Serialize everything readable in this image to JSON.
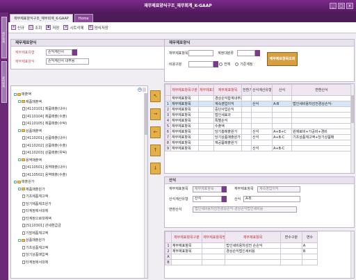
{
  "window": {
    "title": "재무제표양식구조_재무회계_K-GAAP",
    "btn_min": "_",
    "btn_max": "□",
    "btn_close": "x"
  },
  "left_strip": {
    "tab1": "재무회계",
    "tab2": "관리회계"
  },
  "tabs": [
    {
      "label": "재무제표양식구조_재무회계_K-GAAP"
    },
    {
      "label": "Home"
    }
  ],
  "toolbar": {
    "new": "신규",
    "query": "조회",
    "save": "저장",
    "delete": "시트삭제",
    "copy": "양식저장"
  },
  "left_panel": {
    "title": "재무제표양식",
    "fs_label": "재무제표유형",
    "fs_value": "손익계산서",
    "form_label": "재무제표양식",
    "form_value": "손익계산서 내부용"
  },
  "tree": [
    {
      "text": "매출액",
      "lvl": 0,
      "kind": "folder"
    },
    {
      "text": "제품매출액",
      "lvl": 1,
      "kind": "folder"
    },
    {
      "text": "[4110101] 제품매출(내수)",
      "lvl": 2,
      "kind": "leaf"
    },
    {
      "text": "[4110104] 제품매출(수출)",
      "lvl": 2,
      "kind": "leaf"
    },
    {
      "text": "[4110105] 제품매출(수탁)",
      "lvl": 2,
      "kind": "leaf"
    },
    {
      "text": "상품매출액",
      "lvl": 1,
      "kind": "folder"
    },
    {
      "text": "[4110201] 상품매출(내수)",
      "lvl": 2,
      "kind": "leaf"
    },
    {
      "text": "[4110202] 상품매출(수출)",
      "lvl": 2,
      "kind": "leaf"
    },
    {
      "text": "[4110203] 상품매출(위탁)",
      "lvl": 2,
      "kind": "leaf"
    },
    {
      "text": "용역매출액",
      "lvl": 1,
      "kind": "folder"
    },
    {
      "text": "[4110501] 용역매출(내수)",
      "lvl": 2,
      "kind": "leaf"
    },
    {
      "text": "[4110502] 용역매출(수출)",
      "lvl": 2,
      "kind": "leaf"
    },
    {
      "text": "매출원가",
      "lvl": 0,
      "kind": "folder"
    },
    {
      "text": "제품매출원가",
      "lvl": 1,
      "kind": "folder"
    },
    {
      "text": "기초제품재고액",
      "lvl": 2,
      "kind": "leaf"
    },
    {
      "text": "당기제품제조원가",
      "lvl": 2,
      "kind": "leaf"
    },
    {
      "text": "타계정에서대체",
      "lvl": 2,
      "kind": "leaf"
    },
    {
      "text": "타계정으로대체액",
      "lvl": 2,
      "kind": "leaf"
    },
    {
      "text": "[5110301] 관세환급금",
      "lvl": 2,
      "kind": "leaf"
    },
    {
      "text": "기말제품재고액",
      "lvl": 2,
      "kind": "leaf"
    },
    {
      "text": "상품매출원가",
      "lvl": 1,
      "kind": "folder"
    },
    {
      "text": "기초상품재고액",
      "lvl": 2,
      "kind": "leaf"
    },
    {
      "text": "당기상품매입액",
      "lvl": 2,
      "kind": "leaf"
    },
    {
      "text": "타계정에서대체",
      "lvl": 2,
      "kind": "leaf"
    }
  ],
  "right_top": {
    "title": "재무제표양식",
    "f1_label": "재무제표항목",
    "f2_label": "계정대분류",
    "f3_label": "비용구분",
    "radio_all": "전체",
    "radio_base": "기준계정",
    "search_btn": "재무제표항목조회"
  },
  "grid1": {
    "headers": [
      "재무제표항목구분",
      "재무제표항목명칭",
      "재무제표항목",
      "전환기준여부",
      "산식계산유형",
      "산식",
      "변환산식"
    ],
    "rows": [
      {
        "n": "",
        "c1": "재무제표항목",
        "c2": "",
        "c3": "경상손익합계내부용",
        "c4": "",
        "c5": "",
        "c6": "",
        "c7": ""
      },
      {
        "n": "1",
        "c1": "재무제표항목",
        "c2": "",
        "c3": "계속영업이익",
        "c4": "",
        "c5": "산식",
        "c6": "A-B",
        "c7": "법인세비용차감전경상손익-"
      },
      {
        "n": "2",
        "c1": "재무제표항목",
        "c2": "",
        "c3": "중단사업손익",
        "c4": "",
        "c5": "",
        "c6": "",
        "c7": ""
      },
      {
        "n": "3",
        "c1": "재무제표항목",
        "c2": "",
        "c3": "법인세효과",
        "c4": "",
        "c5": "",
        "c6": "",
        "c7": ""
      },
      {
        "n": "4",
        "c1": "재무제표항목",
        "c2": "",
        "c3": "특별손익",
        "c4": "",
        "c5": "",
        "c6": "",
        "c7": ""
      },
      {
        "n": "5",
        "c1": "재무제표항목",
        "c2": "",
        "c3": "수출액",
        "c4": "",
        "c5": "",
        "c6": "",
        "c7": ""
      },
      {
        "n": "6",
        "c1": "재무제표항목",
        "c2": "",
        "c3": "당기총매출원가",
        "c4": "",
        "c5": "산식",
        "c6": "A+B+C",
        "c7": "원재료비+가공비+경비"
      },
      {
        "n": "7",
        "c1": "재무제표항목",
        "c2": "",
        "c3": "당기상품매출원가",
        "c4": "",
        "c5": "산식",
        "c6": "A+B-C",
        "c7": "기초상품재고액+당기상품매"
      },
      {
        "n": "8",
        "c1": "재무제표항목",
        "c2": "",
        "c3": "재공품매출원가",
        "c4": "",
        "c5": "",
        "c6": "",
        "c7": ""
      },
      {
        "n": "9",
        "c1": "재무제표항목",
        "c2": "",
        "c3": "",
        "c4": "",
        "c5": "산식",
        "c6": "A+B-C",
        "c7": ""
      }
    ]
  },
  "calc_panel": {
    "title": "산식",
    "l1": "재무제표항목",
    "v1": "재무제표항목",
    "l2": "재무제표항목",
    "v2": "계속영업이익",
    "l3": "산식계산유형",
    "v3": "산식",
    "l4": "산식",
    "v4": "A-B",
    "l5": "변환산식",
    "v5": "법인세비용차감전경상손익-경상손익법인세비용"
  },
  "grid2": {
    "headers": [
      "재무제표항목구분",
      "재무제표항목명칭",
      "재무제표항목",
      "변수구분",
      "변수"
    ],
    "rows": [
      {
        "n": "1",
        "c1": "재무제표항목",
        "c2": "",
        "c3": "법인세비용차감전 손손익",
        "c4": "",
        "c5": "A"
      },
      {
        "n": "2",
        "c1": "재무제표항목",
        "c2": "",
        "c3": "경상손익법인세비용",
        "c4": "",
        "c5": "B"
      },
      {
        "n": "A",
        "c1": "",
        "c2": "",
        "c3": "",
        "c4": "",
        "c5": ""
      },
      {
        "n": "B",
        "c1": "",
        "c2": "",
        "c3": "",
        "c4": "",
        "c5": ""
      }
    ]
  }
}
